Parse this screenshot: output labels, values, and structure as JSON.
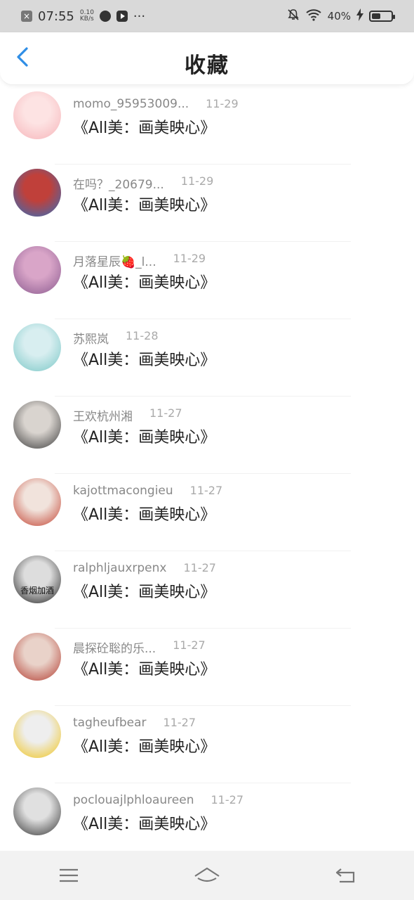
{
  "status_bar": {
    "time": "07:55",
    "net_speed_value": "0.10",
    "net_speed_unit": "KB/s",
    "more": "···",
    "battery_percent": "40%"
  },
  "header": {
    "title": "收藏"
  },
  "items": [
    {
      "name": "momo_95953009...",
      "date": "11-29",
      "subject": "《All美：画美映心》",
      "avatar_colors": [
        "#f6b4b9",
        "#fde3e3"
      ]
    },
    {
      "name": "在吗？_20679...",
      "date": "11-29",
      "subject": "《All美：画美映心》",
      "avatar_colors": [
        "#2e6fbf",
        "#c0403a"
      ]
    },
    {
      "name": "月落星辰🍓_l...",
      "date": "11-29",
      "subject": "《All美：画美映心》",
      "avatar_colors": [
        "#8a5a8f",
        "#d9a5c8"
      ]
    },
    {
      "name": "苏熙岚",
      "date": "11-28",
      "subject": "《All美：画美映心》",
      "avatar_colors": [
        "#79c7c6",
        "#d8eef0"
      ]
    },
    {
      "name": "王欢杭州湘",
      "date": "11-27",
      "subject": "《All美：画美映心》",
      "avatar_colors": [
        "#3a3a3a",
        "#d9d4cf"
      ]
    },
    {
      "name": "kajottmacongieu",
      "date": "11-27",
      "subject": "《All美：画美映心》",
      "avatar_colors": [
        "#c2402f",
        "#f1e3dc"
      ]
    },
    {
      "name": "ralphljauxrpenx",
      "date": "11-27",
      "subject": "《All美：画美映心》",
      "avatar_colors": [
        "#222222",
        "#dddddd"
      ],
      "avatar_text": "香烟加酒"
    },
    {
      "name": "晨探砼聡的乐...",
      "date": "11-27",
      "subject": "《All美：画美映心》",
      "avatar_colors": [
        "#b23a2e",
        "#e9d2c9"
      ]
    },
    {
      "name": "tagheufbear",
      "date": "11-27",
      "subject": "《All美：画美映心》",
      "avatar_colors": [
        "#f0c419",
        "#eeeeee"
      ]
    },
    {
      "name": "poclouajlphloaureen",
      "date": "11-27",
      "subject": "《All美：画美映心》",
      "avatar_colors": [
        "#333333",
        "#e0e0e0"
      ]
    }
  ],
  "colors": {
    "accent": "#2f8ee6",
    "status_bar_bg": "#d9d9d9",
    "nav_bg": "#f2f2f2"
  }
}
